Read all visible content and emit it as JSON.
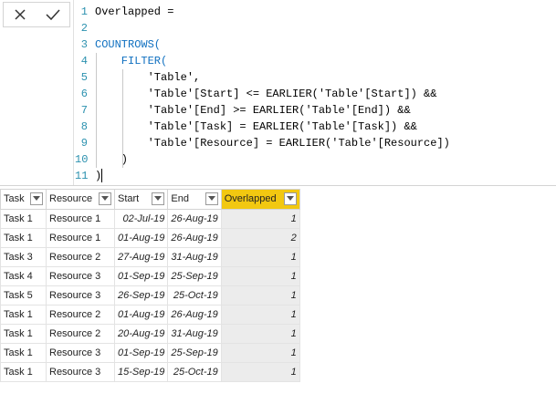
{
  "formula": {
    "lines": [
      {
        "n": "1",
        "text": "Overlapped ="
      },
      {
        "n": "2",
        "text": ""
      },
      {
        "n": "3",
        "text": "COUNTROWS("
      },
      {
        "n": "4",
        "text": "    FILTER("
      },
      {
        "n": "5",
        "text": "        'Table',"
      },
      {
        "n": "6",
        "text": "        'Table'[Start] <= EARLIER('Table'[Start]) &&"
      },
      {
        "n": "7",
        "text": "        'Table'[End] >= EARLIER('Table'[End]) &&"
      },
      {
        "n": "8",
        "text": "        'Table'[Task] = EARLIER('Table'[Task]) &&"
      },
      {
        "n": "9",
        "text": "        'Table'[Resource] = EARLIER('Table'[Resource])"
      },
      {
        "n": "10",
        "text": "    )"
      },
      {
        "n": "11",
        "text": ")"
      }
    ]
  },
  "table": {
    "headers": [
      "Task",
      "Resource",
      "Start",
      "End",
      "Overlapped"
    ],
    "rows": [
      [
        "Task 1",
        "Resource 1",
        "02-Jul-19",
        "26-Aug-19",
        "1"
      ],
      [
        "Task 1",
        "Resource 1",
        "01-Aug-19",
        "26-Aug-19",
        "2"
      ],
      [
        "Task 3",
        "Resource 2",
        "27-Aug-19",
        "31-Aug-19",
        "1"
      ],
      [
        "Task 4",
        "Resource 3",
        "01-Sep-19",
        "25-Sep-19",
        "1"
      ],
      [
        "Task 5",
        "Resource 3",
        "26-Sep-19",
        "25-Oct-19",
        "1"
      ],
      [
        "Task 1",
        "Resource 2",
        "01-Aug-19",
        "26-Aug-19",
        "1"
      ],
      [
        "Task 1",
        "Resource 2",
        "20-Aug-19",
        "31-Aug-19",
        "1"
      ],
      [
        "Task 1",
        "Resource 3",
        "01-Sep-19",
        "25-Sep-19",
        "1"
      ],
      [
        "Task 1",
        "Resource 3",
        "15-Sep-19",
        "25-Oct-19",
        "1"
      ]
    ]
  },
  "colors": {
    "selected_header": "#f2c811",
    "keyword": "#1070c0",
    "line_number": "#2b91af"
  },
  "icons": {
    "cancel": "close-icon",
    "commit": "check-icon"
  }
}
